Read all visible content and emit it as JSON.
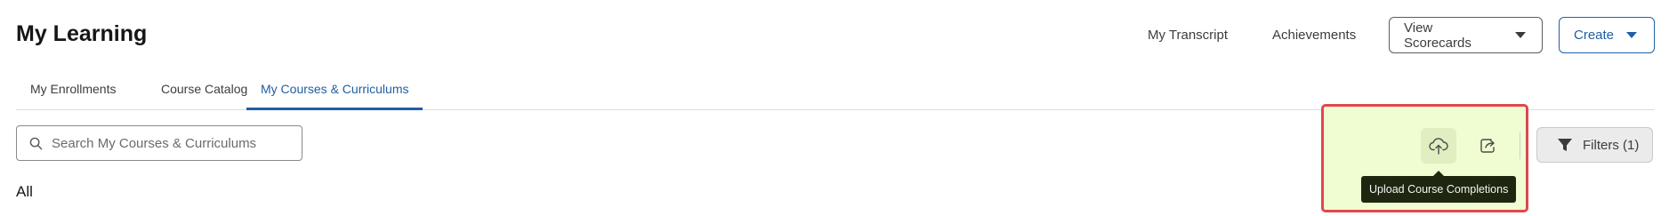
{
  "header": {
    "title": "My Learning",
    "links": {
      "transcript": "My Transcript",
      "achievements": "Achievements"
    },
    "view_scorecards_label": "View Scorecards",
    "create_label": "Create"
  },
  "tabs": [
    {
      "label": "My Enrollments",
      "active": false
    },
    {
      "label": "Course Catalog",
      "active": false
    },
    {
      "label": "My Courses & Curriculums",
      "active": true
    }
  ],
  "search": {
    "placeholder": "Search My Courses & Curriculums",
    "value": ""
  },
  "section": {
    "label": "All"
  },
  "toolbar": {
    "upload_icon": "cloud-upload-icon",
    "export_icon": "export-icon",
    "tooltip": "Upload Course Completions",
    "filters_label": "Filters (1)",
    "filters_icon": "funnel-icon"
  },
  "colors": {
    "accent": "#1f5fa3",
    "highlight_fill": "#f0fcd2",
    "highlight_border": "#e0474c",
    "tooltip_bg": "#1e2610"
  }
}
